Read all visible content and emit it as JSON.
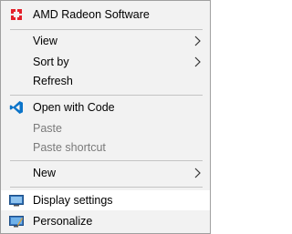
{
  "context_menu": {
    "amd": {
      "label": "AMD Radeon Software",
      "icon": "amd-radeon-icon"
    },
    "view": {
      "label": "View",
      "icon": "chevron-right-icon"
    },
    "sort_by": {
      "label": "Sort by",
      "icon": "chevron-right-icon"
    },
    "refresh": {
      "label": "Refresh"
    },
    "open_with_code": {
      "label": "Open with Code",
      "icon": "vscode-icon"
    },
    "paste": {
      "label": "Paste",
      "state": "disabled"
    },
    "paste_shortcut": {
      "label": "Paste shortcut",
      "state": "disabled"
    },
    "new": {
      "label": "New",
      "icon": "chevron-right-icon"
    },
    "display_settings": {
      "label": "Display settings",
      "icon": "display-settings-icon",
      "state": "highlighted"
    },
    "personalize": {
      "label": "Personalize",
      "icon": "personalize-icon"
    }
  },
  "colors": {
    "menu_background": "#f2f2f2",
    "highlight_background": "#ffffff",
    "disabled_text": "#7a7a7a",
    "amd_red": "#e4202a",
    "vscode_blue": "#0b74c9"
  }
}
